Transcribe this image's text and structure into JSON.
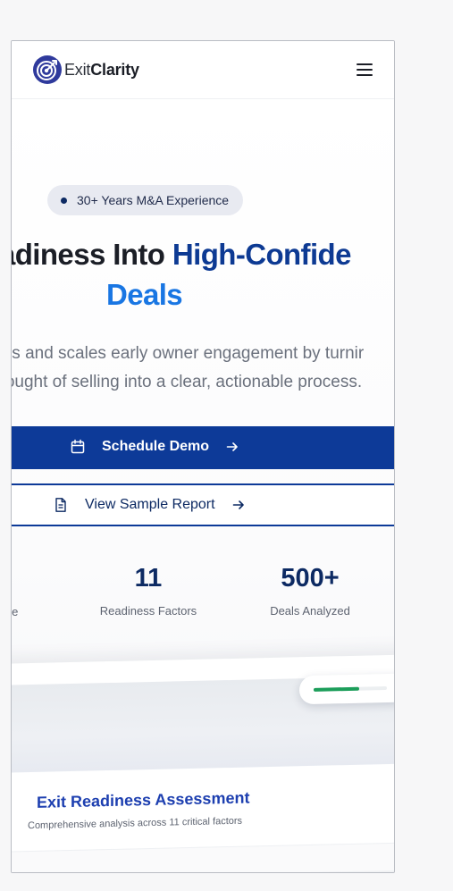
{
  "brand": {
    "name_light": "Exit",
    "name_bold": "Clarity",
    "accent": "#0d3a98",
    "accent_light": "#1976e3"
  },
  "header": {
    "menu_icon": "hamburger-icon"
  },
  "hero": {
    "badge": "30+ Years M&A Experience",
    "headline_line1_dark": "adiness Into ",
    "headline_line1_blue": "High-Confide",
    "headline_line2": "Deals",
    "subtitle_line1": "izes and scales early owner engagement by turnir",
    "subtitle_line2": "thought of selling into a clear, actionable process.",
    "primary_button": "Schedule Demo",
    "secondary_button": "View Sample Report"
  },
  "stats": [
    {
      "value": "",
      "label": "erience"
    },
    {
      "value": "11",
      "label": "Readiness Factors"
    },
    {
      "value": "500+",
      "label": "Deals Analyzed"
    }
  ],
  "preview": {
    "title": "Exit Readiness Assessment",
    "subtitle": "Comprehensive analysis across 11 critical factors",
    "progress_fraction": 0.62
  }
}
